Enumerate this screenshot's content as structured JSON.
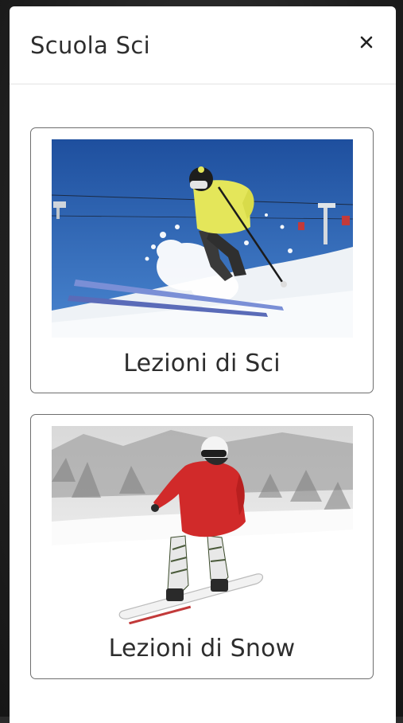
{
  "modal": {
    "title": "Scuola Sci",
    "close_icon": "close-icon"
  },
  "cards": [
    {
      "label": "Lezioni di Sci",
      "image": "skier-jumping-photo"
    },
    {
      "label": "Lezioni di Snow",
      "image": "snowboarder-photo"
    }
  ],
  "colors": {
    "backdrop": "#2b2b2b",
    "card_border": "#6e6e6e",
    "sky": "#2f64b3",
    "jacket_yellow": "#e4e65a",
    "jacket_red": "#d12a2a"
  }
}
